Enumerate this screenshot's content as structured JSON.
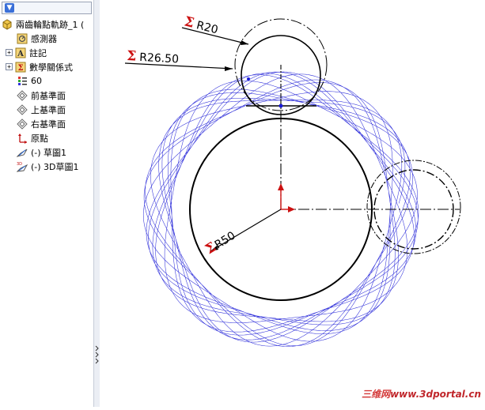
{
  "feature_tree": {
    "part_name": "兩齒輪點軌跡_1 (",
    "items": [
      {
        "label": "感測器",
        "icon": "sensor-icon"
      },
      {
        "label": "註記",
        "icon": "annotation-icon",
        "expandable": true
      },
      {
        "label": "數學關係式",
        "icon": "equations-icon",
        "expandable": true
      },
      {
        "label": "60",
        "icon": "material-icon"
      },
      {
        "label": "前基準面",
        "icon": "plane-icon"
      },
      {
        "label": "上基準面",
        "icon": "plane-icon"
      },
      {
        "label": "右基準面",
        "icon": "plane-icon"
      },
      {
        "label": "原點",
        "icon": "origin-icon"
      },
      {
        "label": "(-) 草圖1",
        "icon": "sketch-icon"
      },
      {
        "label": "(-) 3D草圖1",
        "icon": "3d-sketch-icon"
      }
    ]
  },
  "viewport": {
    "dimensions": [
      {
        "symbol": "Σ",
        "label": "R20"
      },
      {
        "symbol": "Σ",
        "label": "R26.50"
      },
      {
        "symbol": "Σ",
        "label": "R50"
      }
    ],
    "curve_color": "#1a1ad6",
    "dimension_color": "#cc1111",
    "watermark_cn": "三维网",
    "watermark_url": "www.3dportal.cn"
  }
}
